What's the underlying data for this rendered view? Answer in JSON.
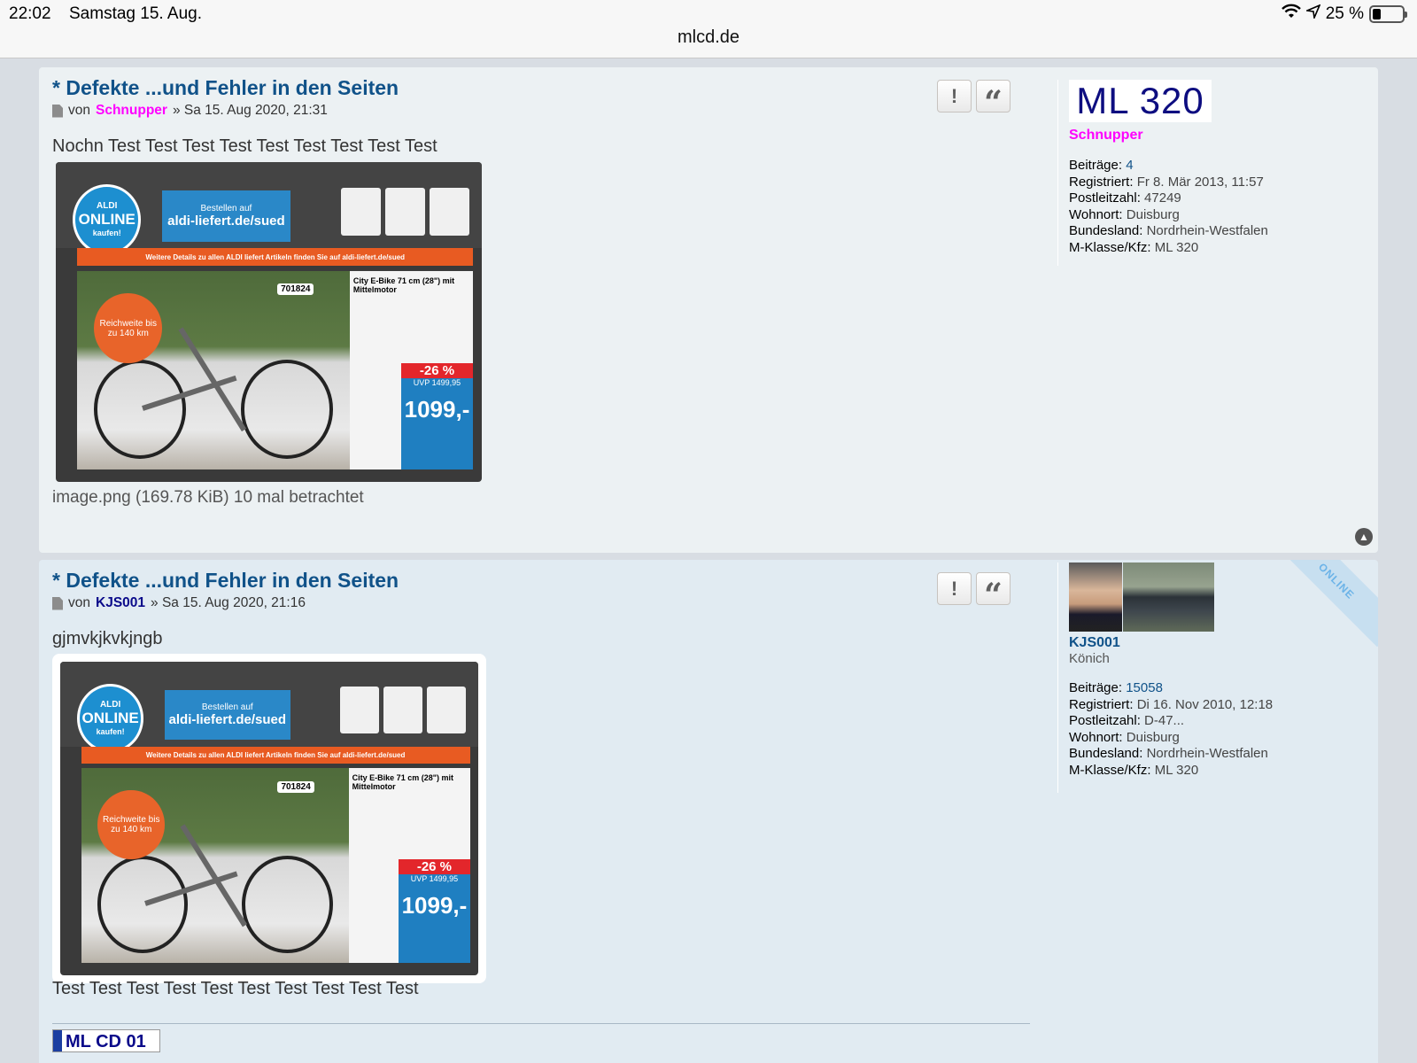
{
  "status": {
    "time": "22:02",
    "date": "Samstag 15. Aug.",
    "battery": "25 %",
    "url": "mlcd.de"
  },
  "posts": [
    {
      "title": "* Defekte ...und Fehler in den Seiten",
      "by_prefix": "von",
      "author": "Schnupper",
      "date": "» Sa 15. Aug 2020, 21:31",
      "text_before": "Nochn Test Test Test Test Test Test Test Test Test",
      "attachment": "image.png (169.78 KiB) 10 mal betrachtet",
      "report_icon": "!",
      "quote_icon": "“",
      "profile": {
        "avatar_text": "ML 320",
        "username": "Schnupper",
        "fields": [
          {
            "label": "Beiträge:",
            "value": "4"
          },
          {
            "label": "Registriert:",
            "value": "Fr 8. Mär 2013, 11:57"
          },
          {
            "label": "Postleitzahl:",
            "value": "47249"
          },
          {
            "label": "Wohnort:",
            "value": "Duisburg"
          },
          {
            "label": "Bundesland:",
            "value": "Nordrhein-Westfalen"
          },
          {
            "label": "M-Klasse/Kfz:",
            "value": "ML 320"
          }
        ]
      }
    },
    {
      "title": "* Defekte ...und Fehler in den Seiten",
      "by_prefix": "von",
      "author": "KJS001",
      "date": "» Sa 15. Aug 2020, 21:16",
      "text_before": "gjmvkjkvkjngb",
      "text_after": "Test Test Test Test Test Test Test Test Test Test",
      "signature": "ML CD 01",
      "online_label": "ONLINE",
      "report_icon": "!",
      "quote_icon": "“",
      "profile": {
        "username": "KJS001",
        "rank": "Könich",
        "fields": [
          {
            "label": "Beiträge:",
            "value": "15058"
          },
          {
            "label": "Registriert:",
            "value": "Di 16. Nov 2010, 12:18"
          },
          {
            "label": "Postleitzahl:",
            "value": "D-47..."
          },
          {
            "label": "Wohnort:",
            "value": "Duisburg"
          },
          {
            "label": "Bundesland:",
            "value": "Nordrhein-Westfalen"
          },
          {
            "label": "M-Klasse/Kfz:",
            "value": "ML 320"
          }
        ]
      }
    }
  ],
  "ad_image": {
    "logo_top": "ALDI",
    "logo": "ONLINE",
    "logo_sub": "kaufen!",
    "site_line1": "Bestellen auf",
    "site": "aldi-liefert.de/sued",
    "band": "Weitere Details zu allen ALDI liefert Artikeln finden Sie auf aldi-liefert.de/sued",
    "sku": "701824",
    "badge": "Reichweite bis zu 140 km",
    "product": "City E-Bike 71 cm (28\") mit Mittelmotor",
    "discount": "-26 %",
    "uvp": "UVP 1499,95",
    "price": "1099,-"
  }
}
